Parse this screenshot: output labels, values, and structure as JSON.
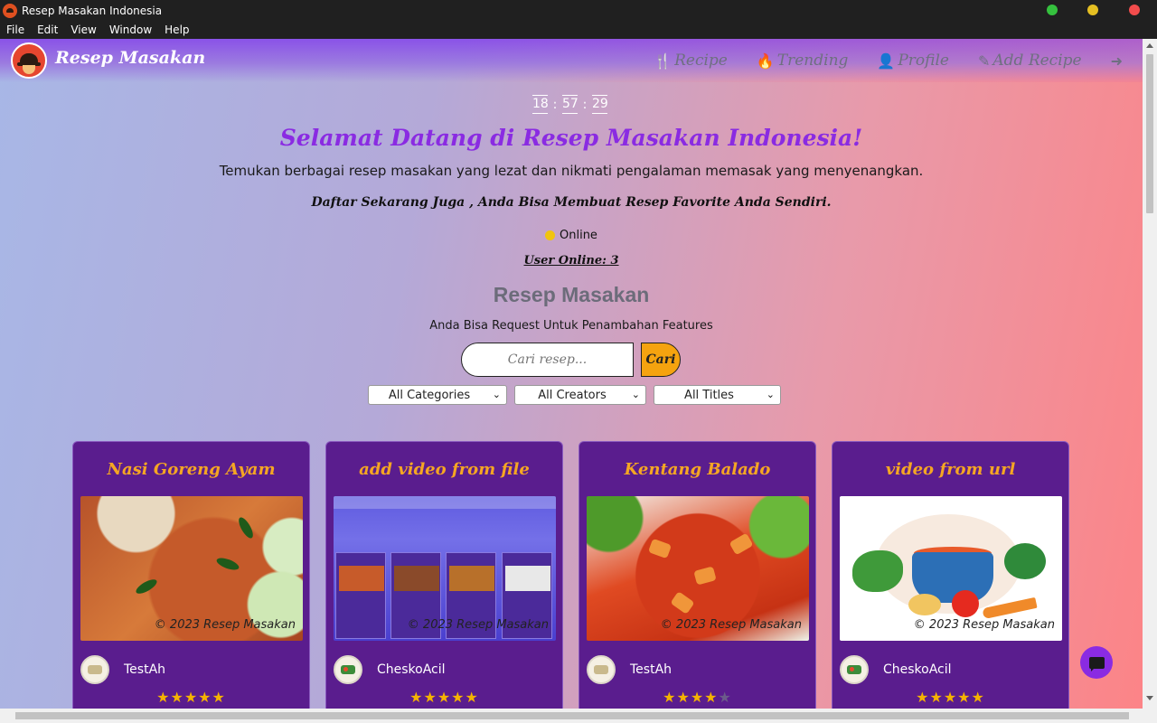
{
  "window": {
    "title": "Resep Masakan Indonesia",
    "menu": [
      "File",
      "Edit",
      "View",
      "Window",
      "Help"
    ]
  },
  "navbar": {
    "brand": "Resep Masakan",
    "links": [
      {
        "label": "Recipe",
        "icon": "utensils-icon",
        "glyph": "🍴"
      },
      {
        "label": "Trending",
        "icon": "fire-icon",
        "glyph": "🔥"
      },
      {
        "label": "Profile",
        "icon": "user-circle-icon",
        "glyph": "👤"
      },
      {
        "label": "Add Recipe",
        "icon": "pencil-icon",
        "glyph": "✎"
      }
    ],
    "logout_glyph": "➜"
  },
  "clock": {
    "hours": "18",
    "minutes": "57",
    "seconds": "29",
    "separator": ":"
  },
  "hero": {
    "welcome": "Selamat Datang di Resep Masakan Indonesia!",
    "tagline": "Temukan berbagai resep masakan yang lezat dan nikmati pengalaman memasak yang menyenangkan.",
    "signup": "Daftar Sekarang Juga , Anda Bisa Membuat Resep Favorite Anda Sendiri.",
    "status": "Online",
    "status_color": "#f1c40f",
    "user_online": "User Online: 3"
  },
  "recipes_section": {
    "title": "Resep Masakan",
    "subtitle": "Anda Bisa Request Untuk Penambahan Features",
    "search_placeholder": "Cari resep...",
    "search_button": "Cari",
    "filters": {
      "category": "All Categories",
      "creator": "All Creators",
      "title": "All Titles"
    }
  },
  "cards": [
    {
      "title": "Nasi Goreng Ayam",
      "watermark": "© 2023 Resep Masakan",
      "creator": "TestAh",
      "rating": 5,
      "stars_on": "★★★★★",
      "stars_off": ""
    },
    {
      "title": "add video from file",
      "watermark": "© 2023 Resep Masakan",
      "creator": "CheskoAcil",
      "rating": 5,
      "stars_on": "★★★★★",
      "stars_off": ""
    },
    {
      "title": "Kentang Balado",
      "watermark": "© 2023 Resep Masakan",
      "creator": "TestAh",
      "rating": 4,
      "stars_on": "★★★★",
      "stars_off": "★"
    },
    {
      "title": "video from url",
      "watermark": "© 2023 Resep Masakan",
      "creator": "CheskoAcil",
      "rating": 5,
      "stars_on": "★★★★★",
      "stars_off": ""
    }
  ],
  "colors": {
    "accent_purple": "#8a2be2",
    "card_bg": "#5a1d8e",
    "card_title": "#f5a623",
    "search_button": "#f5a30f",
    "star": "#f5b301"
  }
}
